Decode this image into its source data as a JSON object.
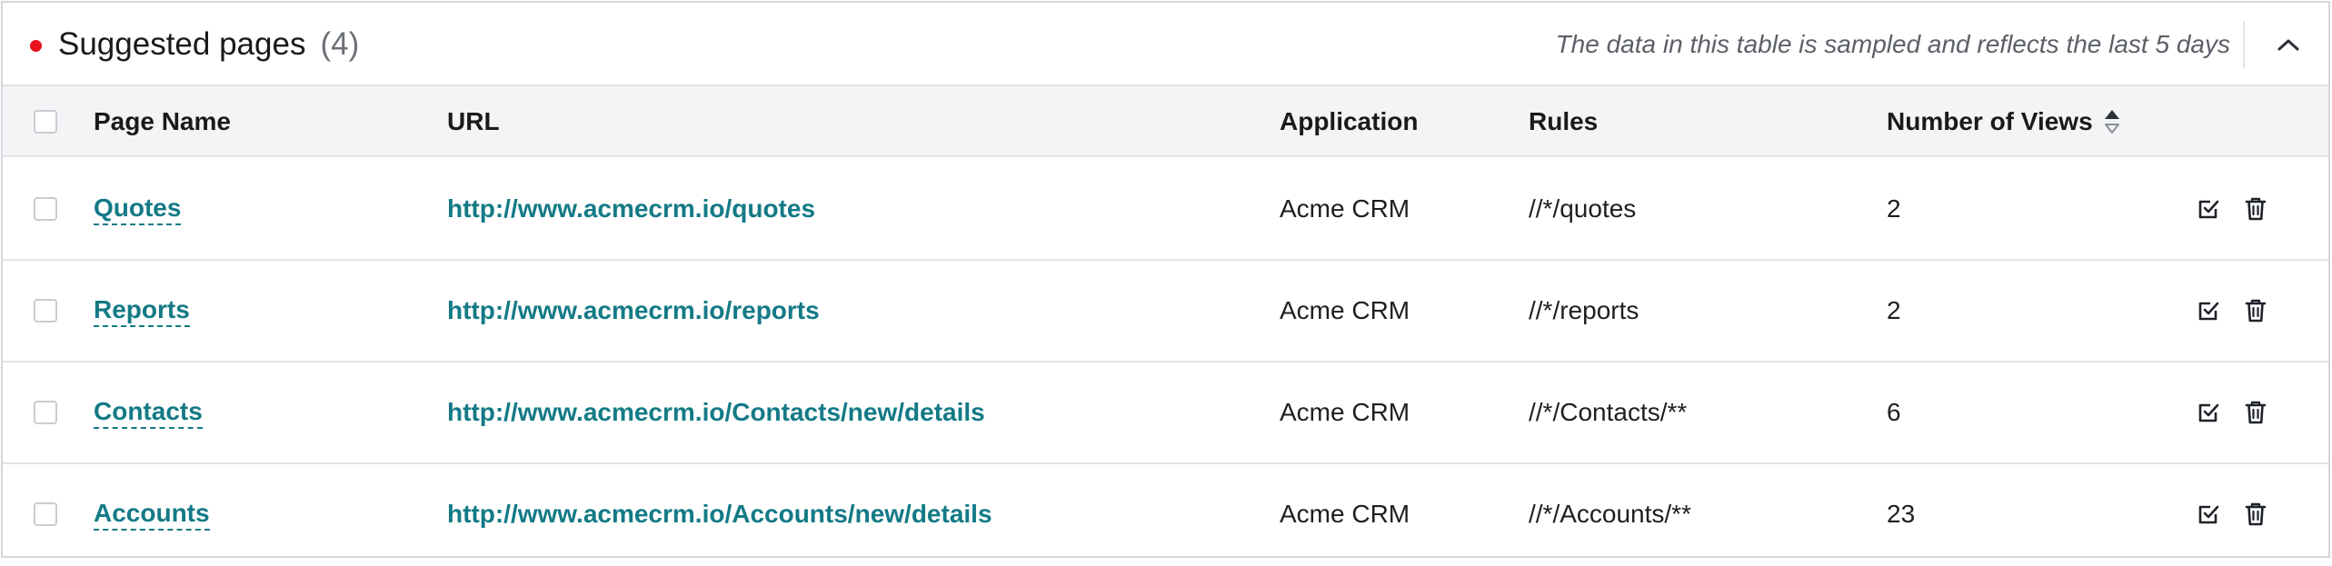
{
  "header": {
    "title": "Suggested pages",
    "count": "(4)",
    "notice": "The data in this table is sampled and reflects the last 5 days",
    "status_color": "#e8131b",
    "collapse_icon": "chevron-up-icon"
  },
  "columns": {
    "page_name": "Page Name",
    "url": "URL",
    "application": "Application",
    "rules": "Rules",
    "views": "Number of Views"
  },
  "rows": [
    {
      "name": "Quotes",
      "url": "http://www.acmecrm.io/quotes",
      "application": "Acme CRM",
      "rules": "//*/quotes",
      "views": "2"
    },
    {
      "name": "Reports",
      "url": "http://www.acmecrm.io/reports",
      "application": "Acme CRM",
      "rules": "//*/reports",
      "views": "2"
    },
    {
      "name": "Contacts",
      "url": "http://www.acmecrm.io/Contacts/new/details",
      "application": "Acme CRM",
      "rules": "//*/Contacts/**",
      "views": "6"
    },
    {
      "name": "Accounts",
      "url": "http://www.acmecrm.io/Accounts/new/details",
      "application": "Acme CRM",
      "rules": "//*/Accounts/**",
      "views": "23"
    }
  ],
  "colors": {
    "link": "#137a86",
    "header_bg": "#f3f4f6",
    "border": "#e2e4e8"
  },
  "icons": {
    "sort": "sort-icon",
    "approve": "check-square-icon",
    "delete": "trash-icon"
  }
}
